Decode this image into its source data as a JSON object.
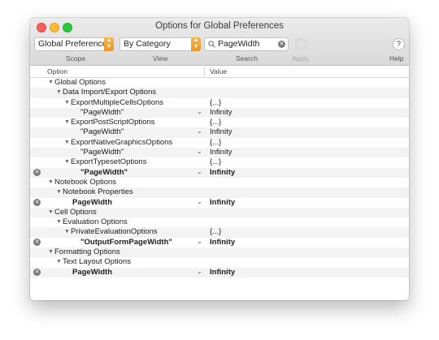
{
  "window": {
    "title": "Options for Global Preferences"
  },
  "toolbar": {
    "scope_value": "Global Preferences",
    "view_value": "By Category",
    "search_value": "PageWidth",
    "help_symbol": "?",
    "labels": {
      "scope": "Scope",
      "view": "View",
      "search": "Search",
      "apply": "Apply",
      "help": "Help"
    }
  },
  "columns": {
    "option": "Option",
    "value": "Value"
  },
  "rows": [
    {
      "indent": 0,
      "expander": true,
      "label": "Global Options",
      "value": ""
    },
    {
      "indent": 1,
      "expander": true,
      "label": "Data Import/Export Options",
      "value": ""
    },
    {
      "indent": 2,
      "expander": true,
      "label": "ExportMultipleCellsOptions",
      "value": "{...}"
    },
    {
      "indent": 3,
      "expander": false,
      "label": "\"PageWidth\"",
      "value": "Infinity",
      "menu": true
    },
    {
      "indent": 2,
      "expander": true,
      "label": "ExportPostScriptOptions",
      "value": "{...}"
    },
    {
      "indent": 3,
      "expander": false,
      "label": "\"PageWidth\"",
      "value": "Infinity",
      "menu": true
    },
    {
      "indent": 2,
      "expander": true,
      "label": "ExportNativeGraphicsOptions",
      "value": "{...}"
    },
    {
      "indent": 3,
      "expander": false,
      "label": "\"PageWidth\"",
      "value": "Infinity",
      "menu": true
    },
    {
      "indent": 2,
      "expander": true,
      "label": "ExportTypesetOptions",
      "value": "{...}"
    },
    {
      "indent": 3,
      "expander": false,
      "label": "\"PageWidth\"",
      "value": "Infinity",
      "menu": true,
      "bold": true,
      "removable": true
    },
    {
      "indent": 0,
      "expander": true,
      "label": "Notebook Options",
      "value": ""
    },
    {
      "indent": 1,
      "expander": true,
      "label": "Notebook Properties",
      "value": ""
    },
    {
      "indent": 2,
      "expander": false,
      "label": "PageWidth",
      "value": "Infinity",
      "menu": true,
      "bold": true,
      "removable": true
    },
    {
      "indent": 0,
      "expander": true,
      "label": "Cell Options",
      "value": ""
    },
    {
      "indent": 1,
      "expander": true,
      "label": "Evaluation Options",
      "value": ""
    },
    {
      "indent": 2,
      "expander": true,
      "label": "PrivateEvaluationOptions",
      "value": "{...}"
    },
    {
      "indent": 3,
      "expander": false,
      "label": "\"OutputFormPageWidth\"",
      "value": "Infinity",
      "menu": true,
      "bold": true,
      "removable": true
    },
    {
      "indent": 0,
      "expander": true,
      "label": "Formatting Options",
      "value": ""
    },
    {
      "indent": 1,
      "expander": true,
      "label": "Text Layout Options",
      "value": ""
    },
    {
      "indent": 2,
      "expander": false,
      "label": "PageWidth",
      "value": "Infinity",
      "menu": true,
      "bold": true,
      "removable": true
    }
  ],
  "colors": {
    "accent": "#f0a43a",
    "close": "#fc5f57",
    "minimize": "#fdbc2e",
    "zoom": "#28c840"
  }
}
